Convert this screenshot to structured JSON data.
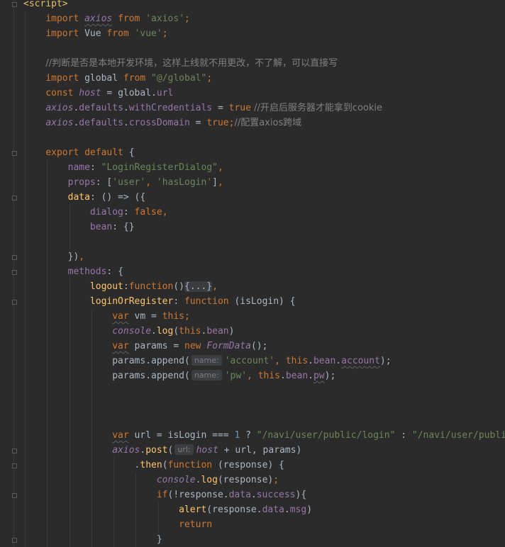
{
  "editor": {
    "language": "Vue single-file component",
    "colors": {
      "background": "#2b2b2b",
      "keyword": "#cc7832",
      "string": "#6a8759",
      "comment": "#808080",
      "property": "#9876aa",
      "function": "#ffc66d",
      "number": "#6897bb",
      "tag": "#e8bf6a",
      "text": "#a9b7c6"
    },
    "lines": [
      [
        {
          "t": "<script>",
          "c": "tag"
        }
      ],
      [
        {
          "t": "    "
        },
        {
          "t": "import ",
          "c": "kw"
        },
        {
          "t": "axios",
          "c": "prop it sq"
        },
        {
          "t": " from ",
          "c": "kw"
        },
        {
          "t": "'axios'",
          "c": "str"
        },
        {
          "t": ";",
          "c": "kw"
        }
      ],
      [
        {
          "t": "    "
        },
        {
          "t": "import ",
          "c": "kw"
        },
        {
          "t": "Vue",
          "c": "plain"
        },
        {
          "t": " from ",
          "c": "kw"
        },
        {
          "t": "'vue'",
          "c": "str"
        },
        {
          "t": ";",
          "c": "kw"
        }
      ],
      [],
      [
        {
          "t": "    "
        },
        {
          "t": "//判断是否是本地开发环境，这样上线就不用更改，不了解，可以直接写",
          "c": "cmt"
        }
      ],
      [
        {
          "t": "    "
        },
        {
          "t": "import ",
          "c": "kw"
        },
        {
          "t": "global",
          "c": "plain"
        },
        {
          "t": " from ",
          "c": "kw"
        },
        {
          "t": "\"@/global\"",
          "c": "str"
        },
        {
          "t": ";",
          "c": "kw"
        }
      ],
      [
        {
          "t": "    "
        },
        {
          "t": "const ",
          "c": "kw"
        },
        {
          "t": "host",
          "c": "prop it"
        },
        {
          "t": " = global.",
          "c": "plain"
        },
        {
          "t": "url",
          "c": "prop"
        }
      ],
      [
        {
          "t": "    "
        },
        {
          "t": "axios",
          "c": "prop it"
        },
        {
          "t": ".",
          "c": "plain"
        },
        {
          "t": "defaults",
          "c": "prop"
        },
        {
          "t": ".",
          "c": "plain"
        },
        {
          "t": "withCredentials",
          "c": "prop"
        },
        {
          "t": " = ",
          "c": "plain"
        },
        {
          "t": "true",
          "c": "kw"
        },
        {
          "t": " //开启后服务器才能拿到cookie",
          "c": "cmt"
        }
      ],
      [
        {
          "t": "    "
        },
        {
          "t": "axios",
          "c": "prop it"
        },
        {
          "t": ".",
          "c": "plain"
        },
        {
          "t": "defaults",
          "c": "prop"
        },
        {
          "t": ".",
          "c": "plain"
        },
        {
          "t": "crossDomain",
          "c": "prop"
        },
        {
          "t": " = ",
          "c": "plain"
        },
        {
          "t": "true",
          "c": "kw"
        },
        {
          "t": ";",
          "c": "kw"
        },
        {
          "t": "//配置axios跨域",
          "c": "cmt"
        }
      ],
      [],
      [
        {
          "t": "    "
        },
        {
          "t": "export default ",
          "c": "kw"
        },
        {
          "t": "{",
          "c": "plain"
        }
      ],
      [
        {
          "t": "        "
        },
        {
          "t": "name",
          "c": "prop"
        },
        {
          "t": ": ",
          "c": "plain"
        },
        {
          "t": "\"LoginRegisterDialog\"",
          "c": "str"
        },
        {
          "t": ",",
          "c": "kw"
        }
      ],
      [
        {
          "t": "        "
        },
        {
          "t": "props",
          "c": "prop"
        },
        {
          "t": ": [",
          "c": "plain"
        },
        {
          "t": "'user'",
          "c": "str"
        },
        {
          "t": ", ",
          "c": "kw"
        },
        {
          "t": "'hasLogin'",
          "c": "str"
        },
        {
          "t": "]",
          "c": "plain"
        },
        {
          "t": ",",
          "c": "kw"
        }
      ],
      [
        {
          "t": "        "
        },
        {
          "t": "data",
          "c": "fn"
        },
        {
          "t": ": () => ({",
          "c": "plain"
        }
      ],
      [
        {
          "t": "            "
        },
        {
          "t": "dialog",
          "c": "prop"
        },
        {
          "t": ": ",
          "c": "plain"
        },
        {
          "t": "false",
          "c": "kw"
        },
        {
          "t": ",",
          "c": "kw"
        }
      ],
      [
        {
          "t": "            "
        },
        {
          "t": "bean",
          "c": "prop"
        },
        {
          "t": ": {}",
          "c": "plain"
        }
      ],
      [],
      [
        {
          "t": "        "
        },
        {
          "t": "})",
          "c": "plain"
        },
        {
          "t": ",",
          "c": "kw"
        }
      ],
      [
        {
          "t": "        "
        },
        {
          "t": "methods",
          "c": "prop"
        },
        {
          "t": ": {",
          "c": "plain"
        }
      ],
      [
        {
          "t": "            "
        },
        {
          "t": "logout",
          "c": "fn"
        },
        {
          "t": ":",
          "c": "plain"
        },
        {
          "t": "function",
          "c": "kw"
        },
        {
          "t": "()",
          "c": "plain"
        },
        {
          "t": "{...}",
          "c": "plain fold"
        },
        {
          "t": ",",
          "c": "kw"
        }
      ],
      [
        {
          "t": "            "
        },
        {
          "t": "loginOrRegister",
          "c": "fn"
        },
        {
          "t": ": ",
          "c": "plain"
        },
        {
          "t": "function ",
          "c": "kw"
        },
        {
          "t": "(isLogin) {",
          "c": "plain"
        }
      ],
      [
        {
          "t": "                "
        },
        {
          "t": "var",
          "c": "kw sq"
        },
        {
          "t": " vm = ",
          "c": "plain"
        },
        {
          "t": "this",
          "c": "kw"
        },
        {
          "t": ";",
          "c": "kw"
        }
      ],
      [
        {
          "t": "                "
        },
        {
          "t": "console",
          "c": "prop it"
        },
        {
          "t": ".",
          "c": "plain"
        },
        {
          "t": "log",
          "c": "fn"
        },
        {
          "t": "(",
          "c": "plain"
        },
        {
          "t": "this",
          "c": "kw"
        },
        {
          "t": ".",
          "c": "plain"
        },
        {
          "t": "bean",
          "c": "prop"
        },
        {
          "t": ")",
          "c": "plain"
        }
      ],
      [
        {
          "t": "                "
        },
        {
          "t": "var",
          "c": "kw sq"
        },
        {
          "t": " params = ",
          "c": "plain"
        },
        {
          "t": "new ",
          "c": "kw"
        },
        {
          "t": "FormData",
          "c": "prop it"
        },
        {
          "t": "();",
          "c": "plain"
        }
      ],
      [
        {
          "t": "                "
        },
        {
          "t": "params.",
          "c": "plain"
        },
        {
          "t": "append",
          "c": "plain"
        },
        {
          "t": "(",
          "c": "plain"
        },
        {
          "t": "name:",
          "h": true
        },
        {
          "t": "'account'",
          "c": "str"
        },
        {
          "t": ", ",
          "c": "kw"
        },
        {
          "t": "this",
          "c": "kw"
        },
        {
          "t": ".",
          "c": "plain"
        },
        {
          "t": "bean",
          "c": "prop"
        },
        {
          "t": ".",
          "c": "plain"
        },
        {
          "t": "account",
          "c": "prop sq"
        },
        {
          "t": ");",
          "c": "plain"
        }
      ],
      [
        {
          "t": "                "
        },
        {
          "t": "params.",
          "c": "plain"
        },
        {
          "t": "append",
          "c": "plain"
        },
        {
          "t": "(",
          "c": "plain"
        },
        {
          "t": "name:",
          "h": true
        },
        {
          "t": "'pw'",
          "c": "str"
        },
        {
          "t": ", ",
          "c": "kw"
        },
        {
          "t": "this",
          "c": "kw"
        },
        {
          "t": ".",
          "c": "plain"
        },
        {
          "t": "bean",
          "c": "prop"
        },
        {
          "t": ".",
          "c": "plain"
        },
        {
          "t": "pw",
          "c": "prop sq"
        },
        {
          "t": ");",
          "c": "plain"
        }
      ],
      [],
      [],
      [],
      [
        {
          "t": "                "
        },
        {
          "t": "var",
          "c": "kw sq"
        },
        {
          "t": " url = isLogin === ",
          "c": "plain"
        },
        {
          "t": "1",
          "c": "num"
        },
        {
          "t": " ? ",
          "c": "plain"
        },
        {
          "t": "\"/navi/user/public/login\"",
          "c": "str"
        },
        {
          "t": " : ",
          "c": "plain"
        },
        {
          "t": "\"/navi/user/public/register\"",
          "c": "str"
        }
      ],
      [
        {
          "t": "                "
        },
        {
          "t": "axios",
          "c": "prop it"
        },
        {
          "t": ".",
          "c": "plain"
        },
        {
          "t": "post",
          "c": "fn"
        },
        {
          "t": "(",
          "c": "plain"
        },
        {
          "t": "url:",
          "h": true
        },
        {
          "t": "host",
          "c": "prop it"
        },
        {
          "t": " + url, params)",
          "c": "plain"
        }
      ],
      [
        {
          "t": "                    "
        },
        {
          "t": ".",
          "c": "plain"
        },
        {
          "t": "then",
          "c": "fn"
        },
        {
          "t": "(",
          "c": "plain"
        },
        {
          "t": "function ",
          "c": "kw"
        },
        {
          "t": "(response) {",
          "c": "plain"
        }
      ],
      [
        {
          "t": "                        "
        },
        {
          "t": "console",
          "c": "prop it"
        },
        {
          "t": ".",
          "c": "plain"
        },
        {
          "t": "log",
          "c": "fn"
        },
        {
          "t": "(response)",
          "c": "plain"
        },
        {
          "t": ";",
          "c": "kw"
        }
      ],
      [
        {
          "t": "                        "
        },
        {
          "t": "if",
          "c": "kw"
        },
        {
          "t": "(!response.",
          "c": "plain"
        },
        {
          "t": "data",
          "c": "prop"
        },
        {
          "t": ".",
          "c": "plain"
        },
        {
          "t": "success",
          "c": "prop"
        },
        {
          "t": "){",
          "c": "plain"
        }
      ],
      [
        {
          "t": "                            "
        },
        {
          "t": "alert",
          "c": "fn"
        },
        {
          "t": "(response.",
          "c": "plain"
        },
        {
          "t": "data",
          "c": "prop"
        },
        {
          "t": ".",
          "c": "plain"
        },
        {
          "t": "msg",
          "c": "prop"
        },
        {
          "t": ")",
          "c": "plain"
        }
      ],
      [
        {
          "t": "                            "
        },
        {
          "t": "return",
          "c": "kw"
        }
      ],
      [
        {
          "t": "                        "
        },
        {
          "t": "}",
          "c": "plain"
        }
      ]
    ]
  }
}
